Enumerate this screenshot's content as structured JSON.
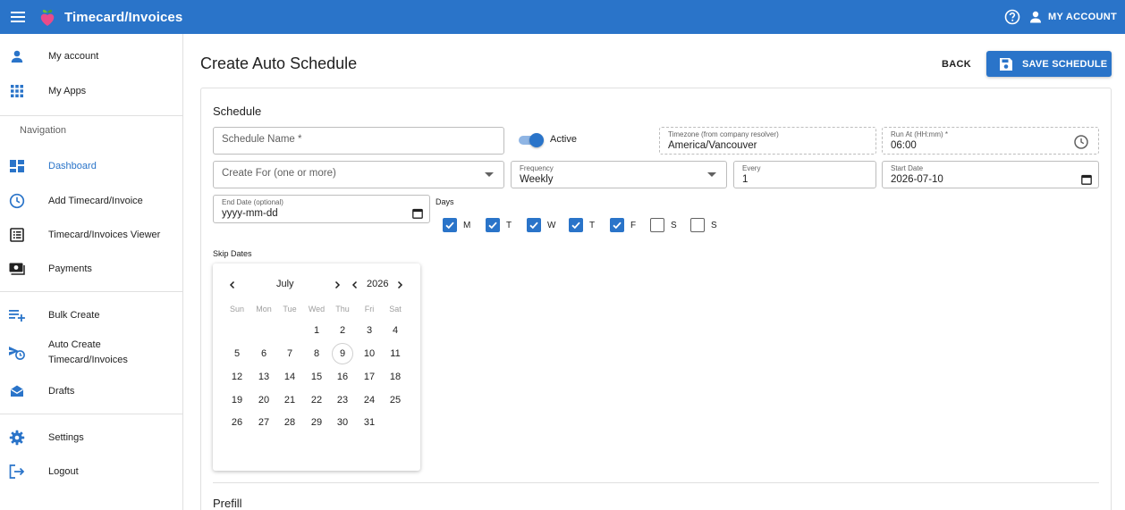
{
  "appbar": {
    "title": "Timecard/Invoices",
    "account_label": "MY ACCOUNT"
  },
  "sidebar": {
    "top_items": [
      {
        "label": "My account",
        "icon": "person-icon"
      },
      {
        "label": "My Apps",
        "icon": "apps-grid-icon"
      }
    ],
    "nav_heading": "Navigation",
    "nav_items": [
      {
        "label": "Dashboard",
        "icon": "dashboard-icon",
        "active": true
      },
      {
        "label": "Add Timecard/Invoice",
        "icon": "clock-icon"
      },
      {
        "label": "Timecard/Invoices Viewer",
        "icon": "list-icon"
      },
      {
        "label": "Payments",
        "icon": "payments-icon"
      }
    ],
    "tool_items": [
      {
        "label": "Bulk Create",
        "icon": "playlist-add-icon"
      },
      {
        "label": "Auto Create Timecard/Invoices",
        "icon": "schedule-send-icon"
      },
      {
        "label": "Drafts",
        "icon": "drafts-icon"
      }
    ],
    "bottom_items": [
      {
        "label": "Settings",
        "icon": "gear-icon"
      },
      {
        "label": "Logout",
        "icon": "logout-icon"
      }
    ]
  },
  "page": {
    "title": "Create Auto Schedule",
    "back_label": "BACK",
    "save_label": "SAVE SCHEDULE"
  },
  "schedule": {
    "section_title": "Schedule",
    "name_placeholder": "Schedule Name *",
    "active_label": "Active",
    "active": true,
    "timezone_label": "Timezone (from company resolver)",
    "timezone_value": "America/Vancouver",
    "run_at_label": "Run At (HH:mm) *",
    "run_at_value": "06:00",
    "create_for_placeholder": "Create For (one or more)",
    "frequency_label": "Frequency",
    "frequency_value": "Weekly",
    "every_label": "Every",
    "every_value": "1",
    "start_date_label": "Start Date",
    "start_date_value": "2026-07-10",
    "end_date_label": "End Date (optional)",
    "end_date_value": "yyyy-mm-dd",
    "days_label": "Days",
    "days": [
      {
        "label": "M",
        "checked": true
      },
      {
        "label": "T",
        "checked": true
      },
      {
        "label": "W",
        "checked": true
      },
      {
        "label": "T",
        "checked": true
      },
      {
        "label": "F",
        "checked": true
      },
      {
        "label": "S",
        "checked": false
      },
      {
        "label": "S",
        "checked": false
      }
    ],
    "skip_dates_label": "Skip Dates"
  },
  "calendar": {
    "month": "July",
    "year": "2026",
    "weekdays": [
      "Sun",
      "Mon",
      "Tue",
      "Wed",
      "Thu",
      "Fri",
      "Sat"
    ],
    "first_weekday_index": 3,
    "days_in_month": 31,
    "today": 9
  },
  "prefill": {
    "section_title": "Prefill"
  },
  "colors": {
    "primary": "#2a74c9",
    "divider": "#e0e0e0"
  }
}
